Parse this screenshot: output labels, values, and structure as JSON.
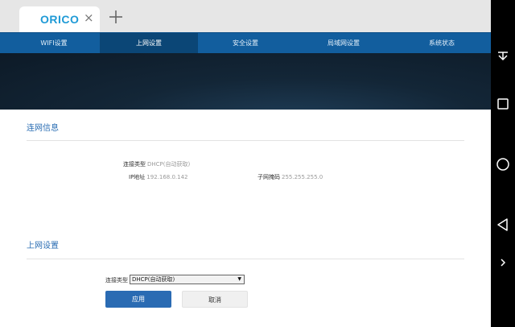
{
  "browser": {
    "tab_title": "ORICO",
    "close_glyph": "×"
  },
  "nav": {
    "items": [
      {
        "label": "WIFI设置"
      },
      {
        "label": "上网设置"
      },
      {
        "label": "安全设置"
      },
      {
        "label": "局域网设置"
      },
      {
        "label": "系统状态"
      }
    ],
    "active_index": 1
  },
  "connection_info": {
    "title": "连网信息",
    "conn_type_label": "连接类型",
    "conn_type_value": "DHCP(自动获取)",
    "ip_label": "IP地址",
    "ip_value": "192.168.0.142",
    "mask_label": "子网掩码",
    "mask_value": "255.255.255.0"
  },
  "internet_settings": {
    "title": "上网设置",
    "conn_type_label": "连接类型",
    "selected_option": "DHCP(自动获取)",
    "apply_label": "应用",
    "cancel_label": "取消"
  },
  "icons": {
    "new_tab": "plus-icon",
    "android": [
      "download-icon",
      "square-icon",
      "circle-icon",
      "back-triangle-icon",
      "chevron-right-icon"
    ]
  },
  "colors": {
    "nav_bg": "#125e9e",
    "nav_active": "#0b4676",
    "accent": "#2a6db3",
    "brand": "#1f9ad6"
  }
}
